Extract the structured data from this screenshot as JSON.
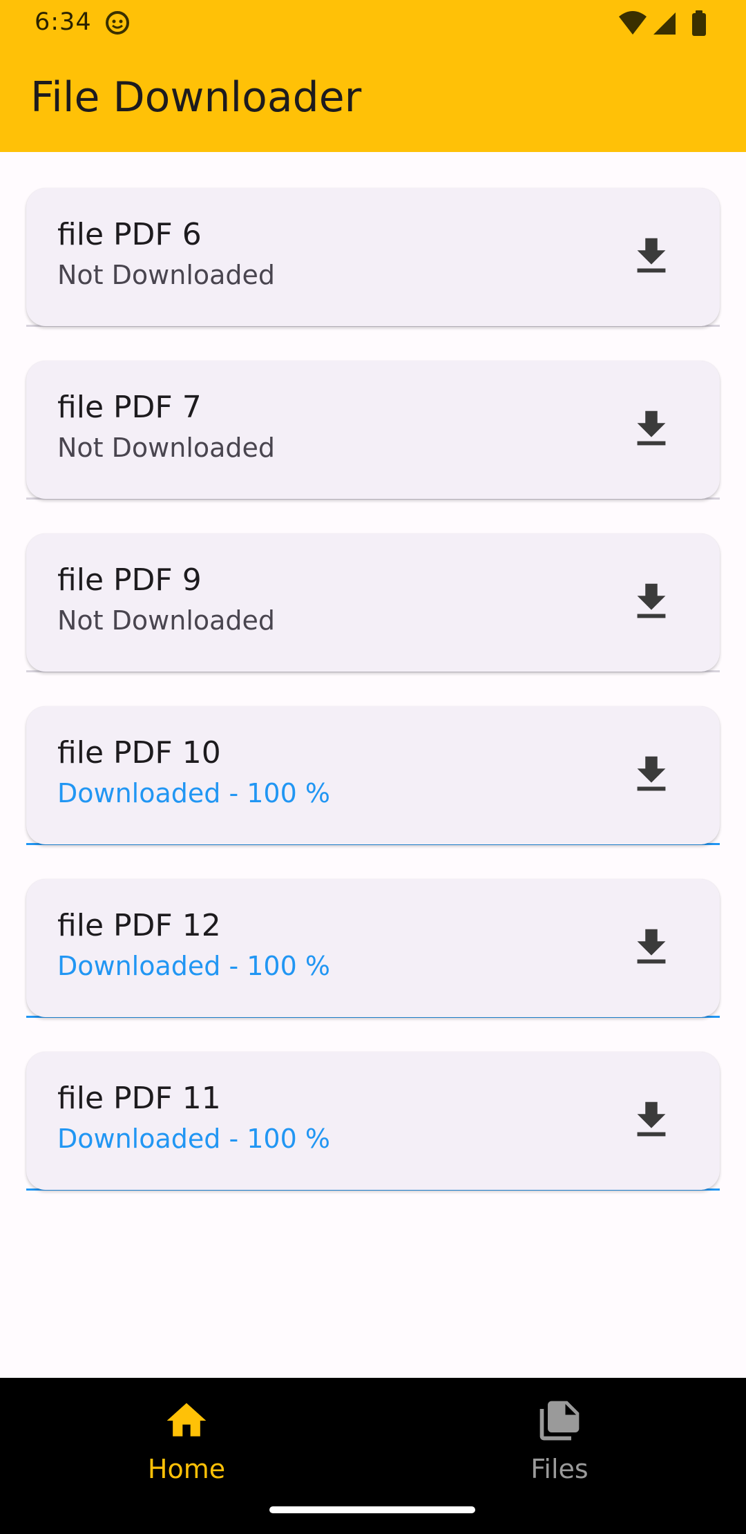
{
  "status_bar": {
    "time": "6:34",
    "icons": [
      "smiley-notification-icon",
      "wifi-icon",
      "signal-icon",
      "battery-icon"
    ]
  },
  "app_bar": {
    "title": "File Downloader",
    "color": "#ffc107"
  },
  "files": [
    {
      "title": "file PDF 6",
      "status": "Not Downloaded",
      "progress": 0
    },
    {
      "title": "file PDF 7",
      "status": "Not Downloaded",
      "progress": 0
    },
    {
      "title": "file PDF 9",
      "status": "Not Downloaded",
      "progress": 0
    },
    {
      "title": "file PDF 10",
      "status": "Downloaded - 100 %",
      "progress": 1
    },
    {
      "title": "file PDF 12",
      "status": "Downloaded - 100 %",
      "progress": 1
    },
    {
      "title": "file PDF 11",
      "status": "Downloaded - 100 %",
      "progress": 1
    }
  ],
  "colors": {
    "downloaded": "#2196f3",
    "not_downloaded": "#49454f",
    "card_bg": "#f4eff7"
  },
  "bottom_nav": {
    "items": [
      {
        "label": "Home",
        "icon": "home-icon",
        "selected": true
      },
      {
        "label": "Files",
        "icon": "files-icon",
        "selected": false
      }
    ]
  }
}
